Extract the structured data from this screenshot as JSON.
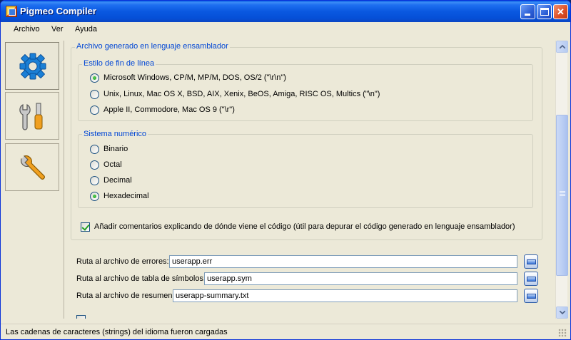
{
  "window": {
    "title": "Pigmeo Compiler",
    "controls": {
      "minimize": "minimize",
      "maximize": "maximize",
      "close": "✕"
    }
  },
  "menu": {
    "items": [
      "Archivo",
      "Ver",
      "Ayuda"
    ]
  },
  "sidebar": {
    "items": [
      {
        "icon": "gear-icon"
      },
      {
        "icon": "tools-icon"
      },
      {
        "icon": "wrench-icon"
      }
    ]
  },
  "main": {
    "asm_group": {
      "title": "Archivo generado en lenguaje ensamblador"
    },
    "eol_group": {
      "title": "Estilo de fin de línea",
      "options": [
        {
          "label": "Microsoft Windows, CP/M, MP/M, DOS, OS/2 (\"\\r\\n\")",
          "checked": true
        },
        {
          "label": "Unix, Linux, Mac OS X, BSD, AIX, Xenix, BeOS, Amiga, RISC OS, Multics  (\"\\n\")",
          "checked": false
        },
        {
          "label": "Apple II, Commodore, Mac OS 9 (\"\\r\")",
          "checked": false
        }
      ]
    },
    "numeric_group": {
      "title": "Sistema numérico",
      "options": [
        {
          "label": "Binario",
          "checked": false
        },
        {
          "label": "Octal",
          "checked": false
        },
        {
          "label": "Decimal",
          "checked": false
        },
        {
          "label": "Hexadecimal",
          "checked": true
        }
      ]
    },
    "comments_checkbox": {
      "label": "Añadir comentarios explicando de dónde viene el código (útil para depurar el código generado en lenguaje ensamblador)",
      "checked": true
    },
    "fields": [
      {
        "label": "Ruta al archivo de errores:",
        "value": "userapp.err"
      },
      {
        "label": "Ruta al archivo de tabla de símbolos:",
        "value": "userapp.sym"
      },
      {
        "label": "Ruta al archivo de resumen:",
        "value": "userapp-summary.txt"
      }
    ]
  },
  "statusbar": {
    "text": "Las cadenas de caracteres (strings) del idioma fueron cargadas"
  },
  "colors": {
    "group_title": "#0046d5",
    "titlebar": "#0a58e0",
    "window_bg": "#ece9d8"
  }
}
